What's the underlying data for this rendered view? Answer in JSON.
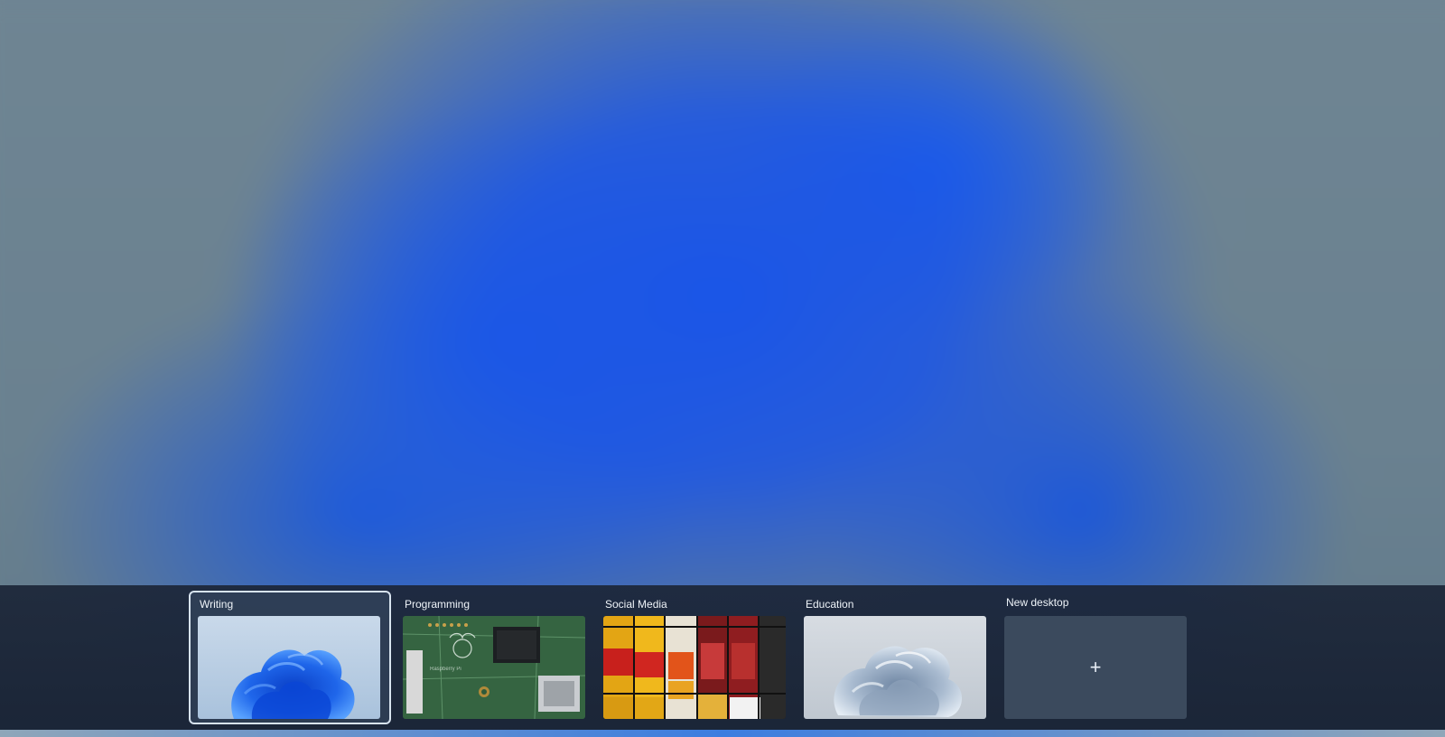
{
  "desktops": [
    {
      "label": "Writing",
      "active": true,
      "thumbnail": "win11-bloom-blue"
    },
    {
      "label": "Programming",
      "active": false,
      "thumbnail": "raspberry-pi-board"
    },
    {
      "label": "Social Media",
      "active": false,
      "thumbnail": "film-boxes"
    },
    {
      "label": "Education",
      "active": false,
      "thumbnail": "win11-bloom-white"
    }
  ],
  "new_desktop": {
    "label": "New desktop",
    "icon": "plus-icon",
    "glyph": "+"
  },
  "colors": {
    "bar": "#1c2638",
    "active_border": "#d7e3ef",
    "wallpaper_blue": "#1a55e8",
    "wallpaper_gray": "#6e8494"
  }
}
